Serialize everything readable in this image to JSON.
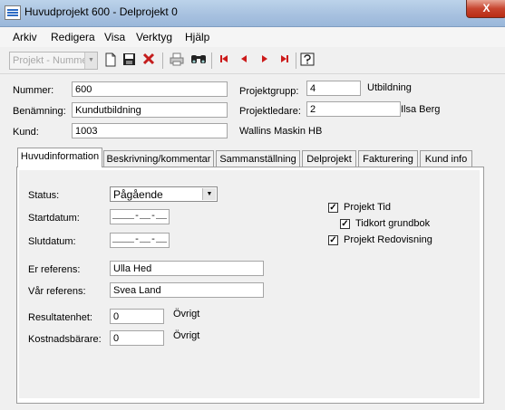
{
  "window": {
    "title": "Huvudprojekt 600 - Delprojekt 0",
    "close_label": "X"
  },
  "menu": [
    {
      "label": "Arkiv"
    },
    {
      "label": "Redigera"
    },
    {
      "label": "Visa"
    },
    {
      "label": "Verktyg"
    },
    {
      "label": "Hjälp"
    }
  ],
  "toolbar": {
    "project_combo_text": "Projekt - Numme",
    "buttons": [
      "new-icon",
      "save-icon",
      "delete-icon",
      "print-icon",
      "find-icon",
      "first-icon",
      "previous-icon",
      "next-icon",
      "last-icon",
      "help-icon"
    ]
  },
  "header": {
    "nummer_label": "Nummer:",
    "nummer_value": "600",
    "benamning_label": "Benämning:",
    "benamning_value": "Kundutbildning",
    "kund_label": "Kund:",
    "kund_value": "1003",
    "kund_name": "Wallins Maskin HB",
    "projektgrupp_label": "Projektgrupp:",
    "projektgrupp_value": "4",
    "projektgrupp_name": "Utbildning",
    "projektledare_label": "Projektledare:",
    "projektledare_value": "2",
    "projektledare_name": "Ilsa Berg"
  },
  "tabs": [
    {
      "label": "Huvudinformation"
    },
    {
      "label": "Beskrivning/kommentar"
    },
    {
      "label": "Sammanställning"
    },
    {
      "label": "Delprojekt"
    },
    {
      "label": "Fakturering"
    },
    {
      "label": "Kund info"
    }
  ],
  "form": {
    "status_label": "Status:",
    "status_value": "Pågående",
    "startdatum_label": "Startdatum:",
    "startdatum_value": "____-__-__",
    "slutdatum_label": "Slutdatum:",
    "slutdatum_value": "____-__-__",
    "er_referens_label": "Er referens:",
    "er_referens_value": "Ulla Hed",
    "var_referens_label": "Vår referens:",
    "var_referens_value": "Svea Land",
    "resultatenhet_label": "Resultatenhet:",
    "resultatenhet_value": "0",
    "resultatenhet_name": "Övrigt",
    "kostnadsbarare_label": "Kostnadsbärare:",
    "kostnadsbarare_value": "0",
    "kostnadsbarare_name": "Övrigt"
  },
  "checkboxes": [
    {
      "label": "Projekt Tid",
      "checked": true
    },
    {
      "label": "Tidkort grundbok",
      "checked": true
    },
    {
      "label": "Projekt Redovisning",
      "checked": true
    }
  ]
}
